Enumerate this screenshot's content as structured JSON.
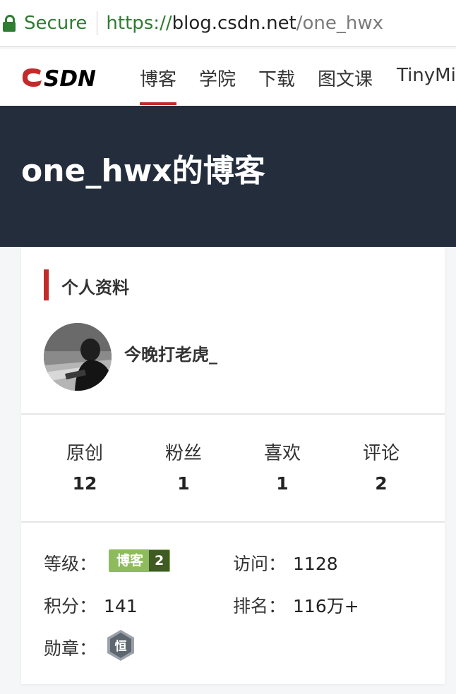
{
  "address_bar": {
    "secure_label": "Secure",
    "url_scheme": "https://",
    "url_host": "blog.csdn.net",
    "url_path": "/one_hwx"
  },
  "nav": {
    "logo_text": "CSDN",
    "items": [
      {
        "label": "博客",
        "active": true
      },
      {
        "label": "学院",
        "active": false
      },
      {
        "label": "下载",
        "active": false
      },
      {
        "label": "图文课",
        "active": false
      },
      {
        "label": "TinyMind",
        "active": false
      }
    ]
  },
  "banner": {
    "title": "one_hwx的博客"
  },
  "profile": {
    "section_title": "个人资料",
    "username": "今晚打老虎_",
    "stats": [
      {
        "label": "原创",
        "value": "12"
      },
      {
        "label": "粉丝",
        "value": "1"
      },
      {
        "label": "喜欢",
        "value": "1"
      },
      {
        "label": "评论",
        "value": "2"
      }
    ],
    "info": {
      "level_label": "等级：",
      "level_badge_text": "博客",
      "level_badge_number": "2",
      "visits_label": "访问：",
      "visits_value": "1128",
      "points_label": "积分：",
      "points_value": "141",
      "rank_label": "排名：",
      "rank_value": "116万+",
      "medal_label": "勋章：",
      "medal_text": "恒"
    }
  },
  "colors": {
    "secure_green": "#2e7d32",
    "brand_red": "#c32b2b",
    "banner_bg": "#232d3b",
    "badge_green": "#8dbb5e",
    "badge_dark": "#3f5a22",
    "medal_gray": "#5e6770"
  },
  "icons": {
    "lock": "lock-icon",
    "medal": "medal-hexagon-icon",
    "avatar": "avatar-photo"
  }
}
